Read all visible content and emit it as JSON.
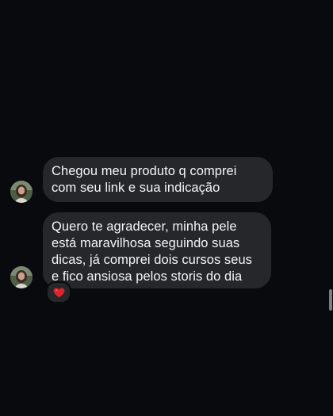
{
  "thread": {
    "messages": [
      {
        "sender": "incoming",
        "text": "Chegou meu produto q comprei com seu link e sua indicação"
      },
      {
        "sender": "incoming",
        "text": "Quero te agradecer, minha pele está maravilhosa seguindo suas dicas, já comprei dois cursos seus e fico ansiosa pelos storis do dia",
        "reaction": "❤️"
      }
    ]
  },
  "colors": {
    "background": "#080a0d",
    "bubble": "#25272b",
    "text": "#f4f5f7",
    "heart": "#e0232b",
    "scrollbar": "#7b7d81"
  },
  "icons": {
    "avatar": "user-avatar",
    "reaction": "heart-icon"
  }
}
